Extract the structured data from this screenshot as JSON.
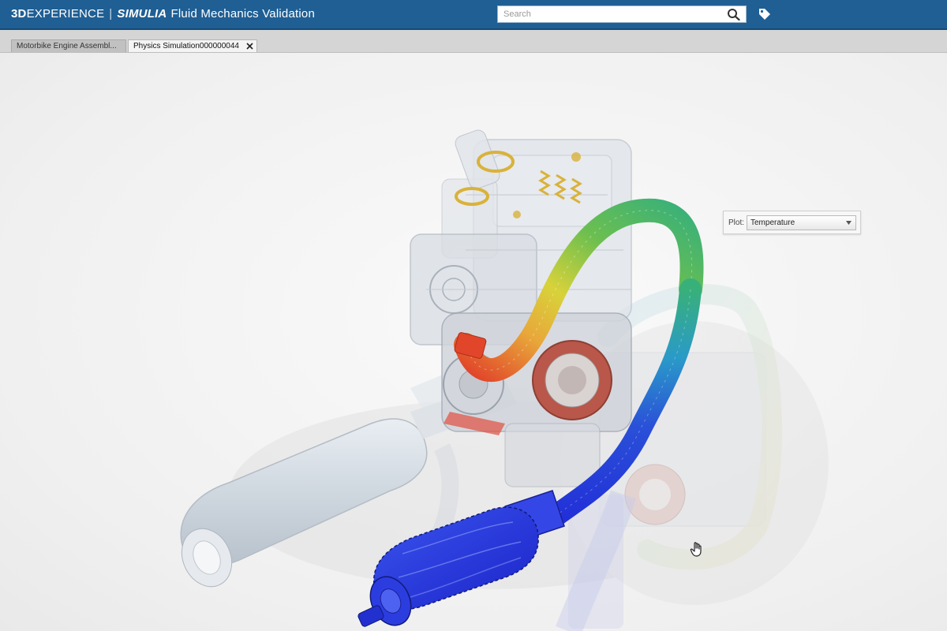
{
  "header": {
    "brand_3d": "3D",
    "brand_experience": "EXPERIENCE",
    "brand_separator": "|",
    "brand_simulia": "SIMULIA",
    "app_title": "Fluid Mechanics Validation",
    "search_placeholder": "Search",
    "search_icon": "magnifier",
    "tag_icon": "tag"
  },
  "tabs": [
    {
      "label": "Motorbike Engine Assembl...",
      "active": false
    },
    {
      "label": "Physics Simulation000000044",
      "active": true,
      "close_icon": "close-x"
    }
  ],
  "plot_control": {
    "label": "Plot:",
    "selected": "Temperature"
  },
  "colors": {
    "header_bg": "#1f5f94",
    "tab_strip_bg": "#d5d5d5",
    "viewport_bg": "#f1f1f1",
    "temperature_hot": "#e1462a",
    "temperature_warm": "#e8d23a",
    "temperature_mid": "#38b07a",
    "temperature_cold": "#2230d8"
  }
}
